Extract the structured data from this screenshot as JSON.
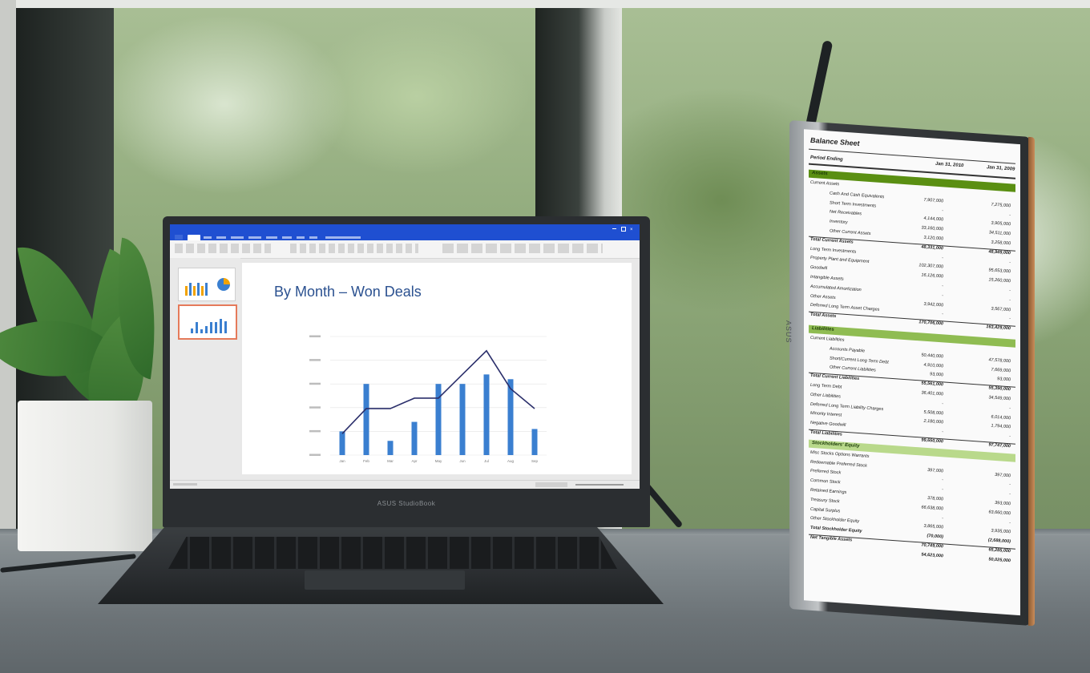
{
  "laptop": {
    "brand": "ASUS StudioBook"
  },
  "presentation": {
    "slide_title": "By Month – Won Deals",
    "thumbnails": [
      {
        "title": "",
        "type": "bar-pie"
      },
      {
        "title": "",
        "type": "bar-line",
        "selected": true
      }
    ],
    "colors": {
      "bar": "#3a7fd0",
      "line": "#2b2f6b",
      "title": "#2b5190",
      "titlebar": "#1f4fd1"
    }
  },
  "chart_data": {
    "type": "bar",
    "title": "By Month – Won Deals",
    "categories": [
      "Jan",
      "Feb",
      "Mar",
      "Apr",
      "May",
      "Jun",
      "Jul",
      "Aug",
      "Sep"
    ],
    "series": [
      {
        "type": "bar",
        "values": [
          5,
          15,
          3,
          7,
          15,
          15,
          17,
          16,
          5.5
        ]
      },
      {
        "type": "line",
        "values": [
          4.5,
          9.8,
          9.8,
          12,
          12,
          17,
          22,
          14,
          9.8
        ]
      }
    ],
    "ylim": [
      0,
      25
    ],
    "grid": true
  },
  "monitor": {
    "logo": "ASUS",
    "balance_sheet": {
      "title": "Balance Sheet",
      "period_label": "Period Ending",
      "col1": "Jan 31, 2010",
      "col2": "Jan 31, 2009",
      "assets_label": "Assets",
      "liabilities_label": "Liabilities",
      "equity_label": "Stockholders' Equity",
      "rows": [
        {
          "label": "Current Assets",
          "v1": "",
          "v2": "",
          "indent": 0
        },
        {
          "label": "Cash And Cash Equivalents",
          "v1": "7,907,000",
          "v2": "7,275,000",
          "indent": 2
        },
        {
          "label": "Short Term Investments",
          "v1": "-",
          "v2": "-",
          "indent": 2
        },
        {
          "label": "Net Receivables",
          "v1": "4,144,000",
          "v2": "3,905,000",
          "indent": 2
        },
        {
          "label": "Inventory",
          "v1": "33,160,000",
          "v2": "34,511,000",
          "indent": 2
        },
        {
          "label": "Other Current Assets",
          "v1": "3,120,000",
          "v2": "3,258,000",
          "indent": 2
        },
        {
          "label": "Total Current Assets",
          "v1": "48,331,000",
          "v2": "48,949,000",
          "indent": 0,
          "bold": true,
          "rule": true
        },
        {
          "label": "Long Term Investments",
          "v1": "-",
          "v2": "-",
          "indent": 0
        },
        {
          "label": "Property Plant and Equipment",
          "v1": "102,307,000",
          "v2": "95,653,000",
          "indent": 0
        },
        {
          "label": "Goodwill",
          "v1": "16,126,000",
          "v2": "15,260,000",
          "indent": 0
        },
        {
          "label": "Intangible Assets",
          "v1": "-",
          "v2": "-",
          "indent": 0
        },
        {
          "label": "Accumulated Amortization",
          "v1": "-",
          "v2": "-",
          "indent": 0
        },
        {
          "label": "Other Assets",
          "v1": "3,942,000",
          "v2": "3,567,000",
          "indent": 0
        },
        {
          "label": "Deferred Long Term Asset Charges",
          "v1": "-",
          "v2": "-",
          "indent": 0
        },
        {
          "label": "Total Assets",
          "v1": "170,706,000",
          "v2": "163,429,000",
          "indent": 0,
          "bold": true,
          "rule": true
        },
        {
          "label": "Current Liabilities",
          "v1": "",
          "v2": "",
          "indent": 0,
          "gap": true
        },
        {
          "label": "Accounts Payable",
          "v1": "50,440,000",
          "v2": "47,578,000",
          "indent": 2
        },
        {
          "label": "Short/Current Long Term Debt",
          "v1": "4,910,000",
          "v2": "7,669,000",
          "indent": 2
        },
        {
          "label": "Other Current Liabilities",
          "v1": "93,000",
          "v2": "93,000",
          "indent": 2
        },
        {
          "label": "Total Current Liabilities",
          "v1": "55,561,000",
          "v2": "55,390,000",
          "indent": 0,
          "bold": true,
          "rule": true
        },
        {
          "label": "Long Term Debt",
          "v1": "36,401,000",
          "v2": "34,549,000",
          "indent": 0
        },
        {
          "label": "Other Liabilities",
          "v1": "-",
          "v2": "-",
          "indent": 0
        },
        {
          "label": "Deferred Long Term Liability Charges",
          "v1": "5,508,000",
          "v2": "6,014,000",
          "indent": 0
        },
        {
          "label": "Minority Interest",
          "v1": "2,180,000",
          "v2": "1,794,000",
          "indent": 0
        },
        {
          "label": "Negative Goodwill",
          "v1": "-",
          "v2": "-",
          "indent": 0
        },
        {
          "label": "Total Liabilities",
          "v1": "99,650,000",
          "v2": "97,747,000",
          "indent": 0,
          "bold": true,
          "rule": true
        },
        {
          "label": "Misc Stocks Options Warrants",
          "v1": "",
          "v2": "",
          "indent": 0,
          "gap": true
        },
        {
          "label": "Redeemable Preferred Stock",
          "v1": "397,000",
          "v2": "397,000",
          "indent": 0
        },
        {
          "label": "Preferred Stock",
          "v1": "-",
          "v2": "-",
          "indent": 0
        },
        {
          "label": "Common Stock",
          "v1": "-",
          "v2": "-",
          "indent": 0
        },
        {
          "label": "Retained Earnings",
          "v1": "378,000",
          "v2": "393,000",
          "indent": 0
        },
        {
          "label": "Treasury Stock",
          "v1": "66,638,000",
          "v2": "63,660,000",
          "indent": 0
        },
        {
          "label": "Capital Surplus",
          "v1": "-",
          "v2": "-",
          "indent": 0
        },
        {
          "label": "Other Stockholder Equity",
          "v1": "3,865,000",
          "v2": "3,935,000",
          "indent": 0
        },
        {
          "label": "Total Stockholder Equity",
          "v1": "(70,000)",
          "v2": "(2,688,000)",
          "indent": 0,
          "bold": true
        },
        {
          "label": "Net Tangible Assets",
          "v1": "70,749,000",
          "v2": "65,285,000",
          "indent": 0,
          "bold": true,
          "rule": true
        },
        {
          "label": "",
          "v1": "54,623,000",
          "v2": "50,025,000",
          "indent": 0,
          "bold": true
        }
      ]
    }
  }
}
